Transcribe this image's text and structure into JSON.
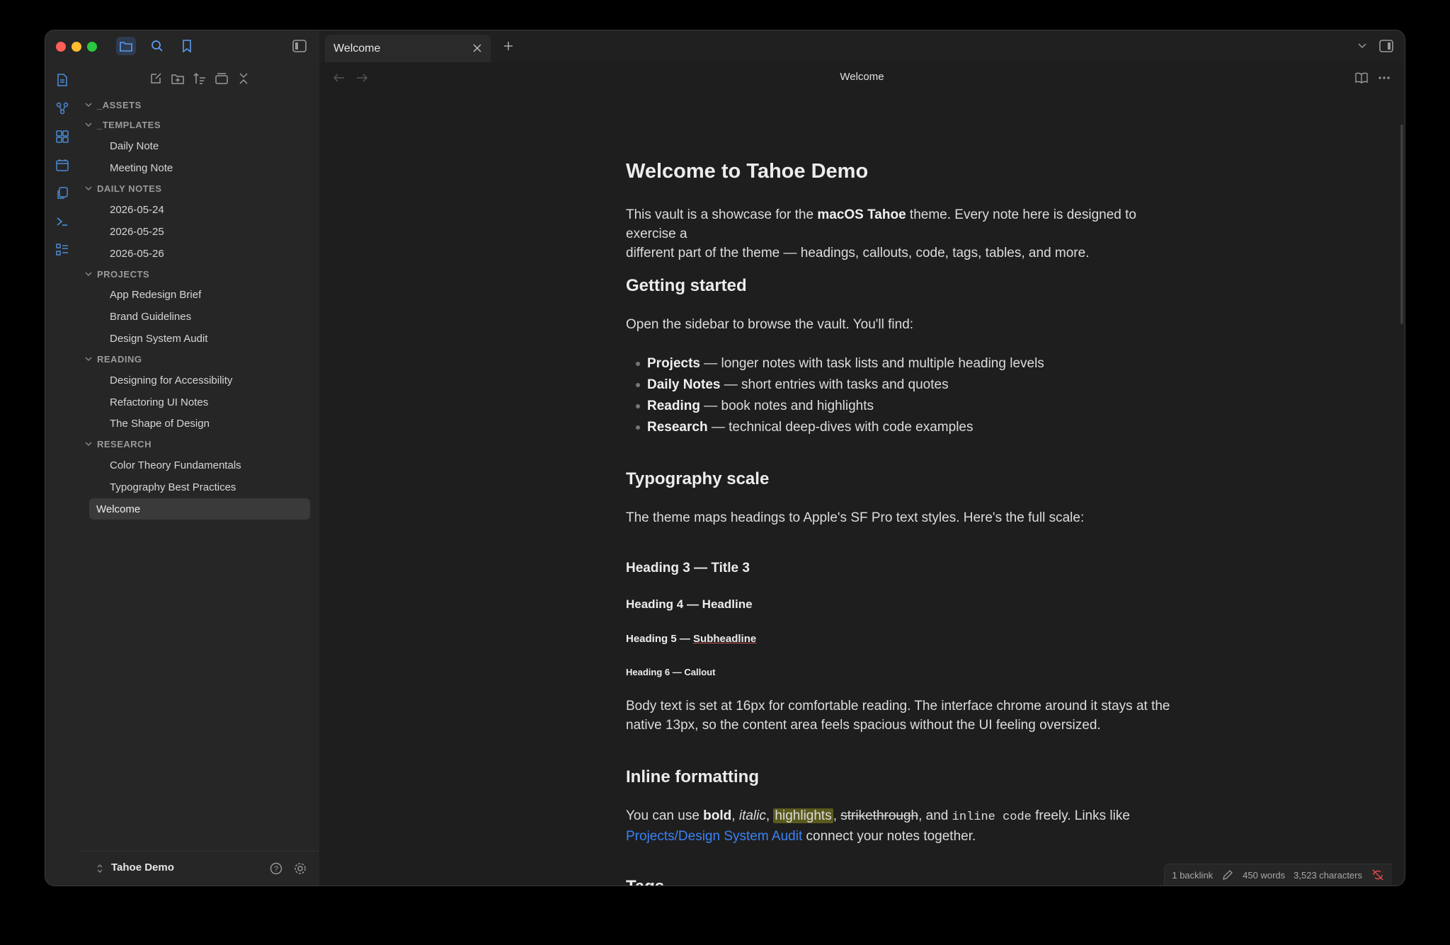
{
  "window": {
    "traffic_colors": [
      "#ff5f57",
      "#febc2e",
      "#28c840"
    ]
  },
  "tab": {
    "label": "Welcome"
  },
  "header": {
    "title": "Welcome"
  },
  "sidebar": {
    "folders": [
      {
        "label": "_ASSETS",
        "files": []
      },
      {
        "label": "_TEMPLATES",
        "files": [
          "Daily Note",
          "Meeting Note"
        ]
      },
      {
        "label": "DAILY NOTES",
        "files": [
          "2026-05-24",
          "2026-05-25",
          "2026-05-26"
        ]
      },
      {
        "label": "PROJECTS",
        "files": [
          "App Redesign Brief",
          "Brand Guidelines",
          "Design System Audit"
        ]
      },
      {
        "label": "READING",
        "files": [
          "Designing for Accessibility",
          "Refactoring UI Notes",
          "The Shape of Design"
        ]
      },
      {
        "label": "RESEARCH",
        "files": [
          "Color Theory Fundamentals",
          "Typography Best Practices"
        ]
      }
    ],
    "active_file": "Welcome",
    "vault_name": "Tahoe Demo"
  },
  "note": {
    "title": "Welcome to Tahoe Demo",
    "intro_a": "This vault is a showcase for the ",
    "intro_bold": "macOS Tahoe",
    "intro_b": " theme. Every note here is designed to exercise a",
    "intro_line2": "different part of the theme — headings, callouts, code, tags, tables, and more.",
    "h_getting_started": "Getting started",
    "open_sidebar": "Open the sidebar to browse the vault. You'll find:",
    "bullets": [
      {
        "bold": "Projects",
        "rest": " — longer notes with task lists and multiple heading levels"
      },
      {
        "bold": "Daily Notes",
        "rest": " — short entries with tasks and quotes"
      },
      {
        "bold": "Reading",
        "rest": " — book notes and highlights"
      },
      {
        "bold": "Research",
        "rest": " — technical deep-dives with code examples"
      }
    ],
    "h_typography": "Typography scale",
    "typo_intro": "The theme maps headings to Apple's SF Pro text styles. Here's the full scale:",
    "h3": "Heading 3 — Title 3",
    "h4": "Heading 4 — Headline",
    "h5a": "Heading 5 — ",
    "h5b": "Subheadline",
    "h6": "Heading 6 — Callout",
    "body_line1": "Body text is set at 16px for comfortable reading. The interface chrome around it stays at the",
    "body_line2": "native 13px, so the content area feels spacious without the UI feeling oversized.",
    "h_inline": "Inline formatting",
    "inline_pre": "You can use ",
    "inline_bold": "bold",
    "inline_c1": ", ",
    "inline_italic": "italic",
    "inline_c2": ", ",
    "inline_hl": "highlights",
    "inline_c3": ", ",
    "inline_strike": "strikethrough",
    "inline_and": ", and ",
    "inline_code": "inline code",
    "inline_post": " freely. Links like",
    "inline_link": "Projects/Design System Audit",
    "inline_link_post": " connect your notes together.",
    "h_tags": "Tags"
  },
  "status": {
    "backlinks": "1 backlink",
    "words": "450 words",
    "chars": "3,523 characters"
  },
  "colors": {
    "accent": "#4a8bd6",
    "link": "#3b82f6"
  }
}
